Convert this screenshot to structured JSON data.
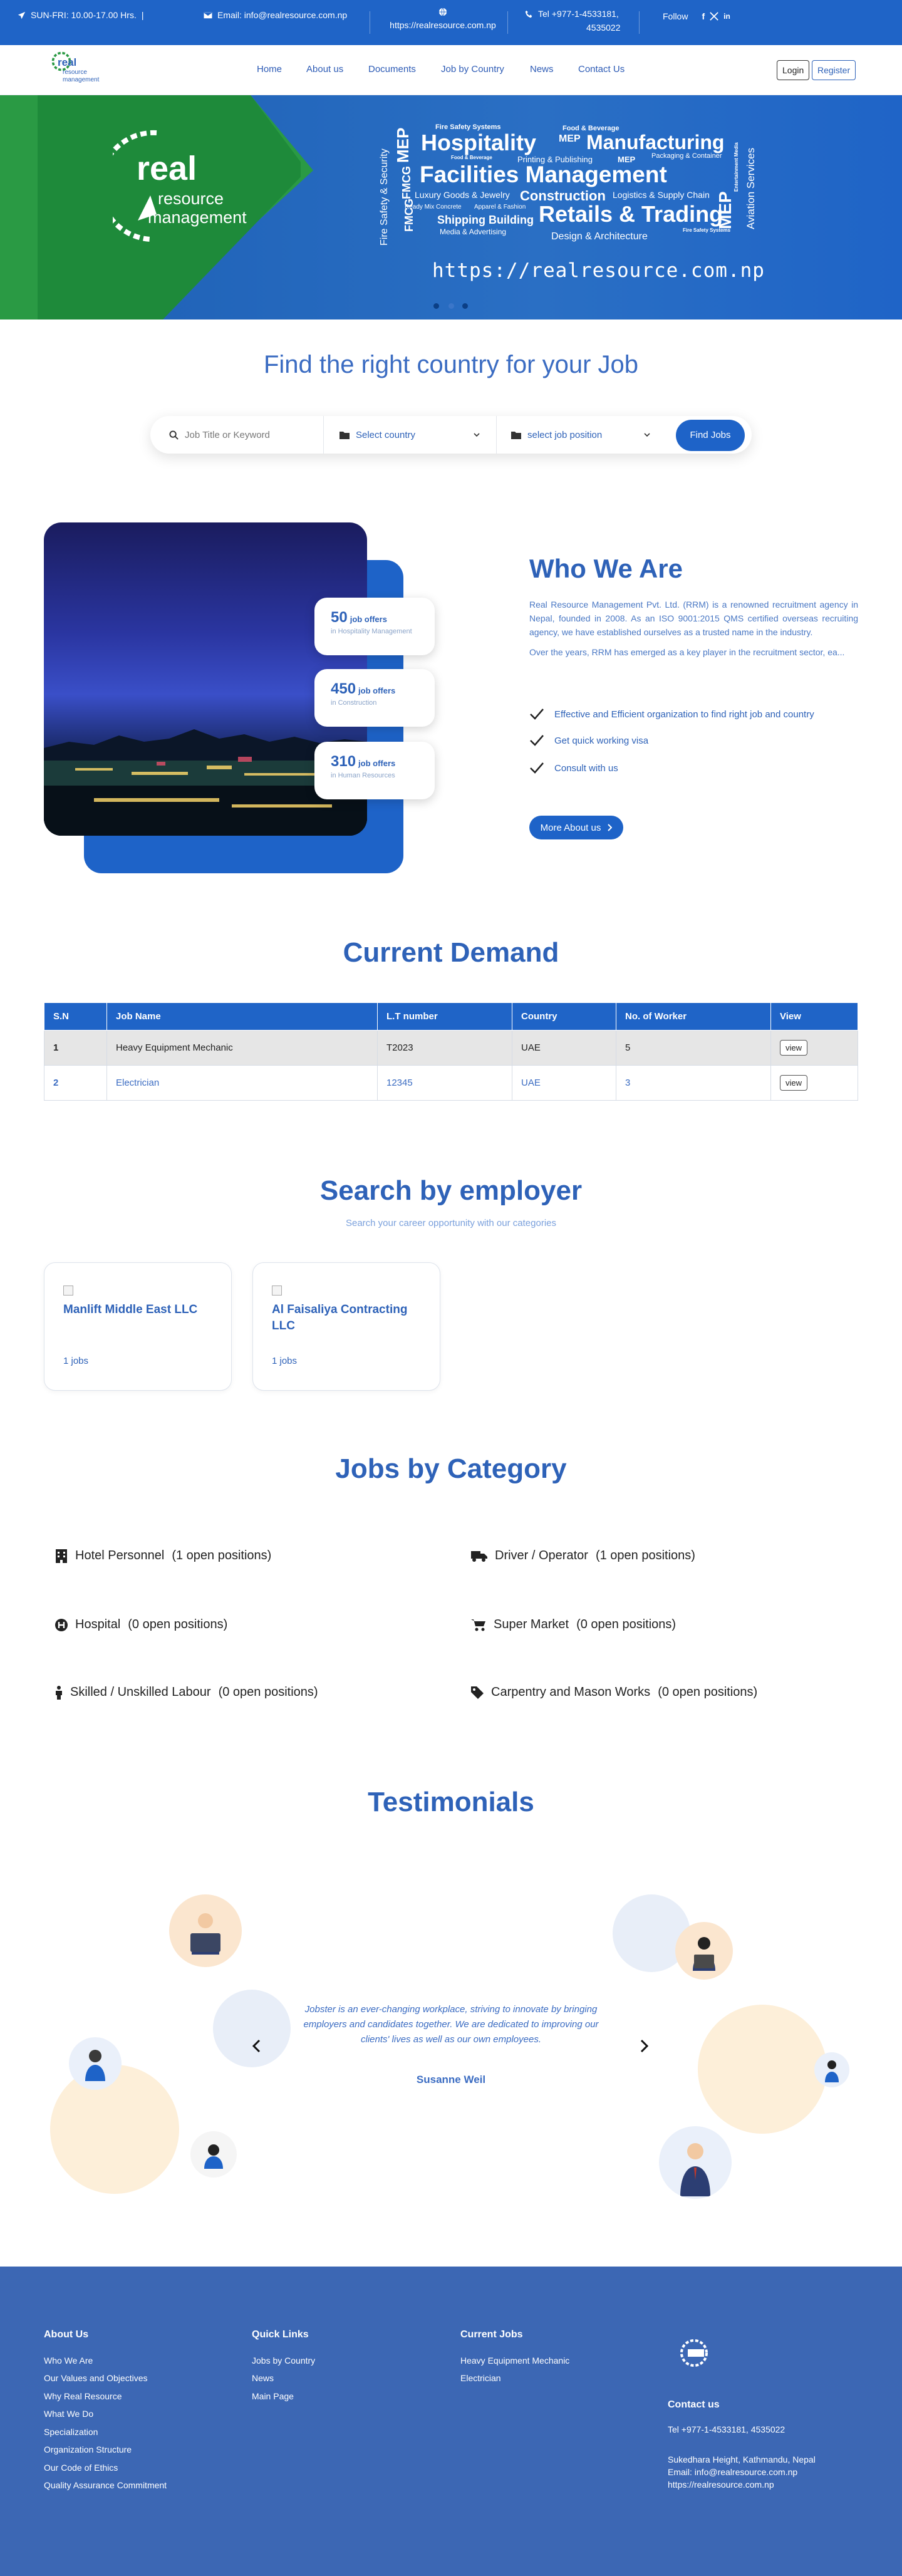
{
  "topbar": {
    "hours": "SUN-FRI: 10.00-17.00 Hrs.",
    "pipe": "|",
    "email": "Email: info@realresource.com.np",
    "website": "https://realresource.com.np",
    "tel_line1": "Tel +977-1-4533181,",
    "tel_line2": "4535022",
    "follow": "Follow"
  },
  "nav": {
    "logo_line1": "real",
    "logo_line2": "resource",
    "logo_line3": "management",
    "links": [
      "Home",
      "About us",
      "Documents",
      "Job by Country",
      "News",
      "Contact Us"
    ],
    "login": "Login",
    "register": "Register"
  },
  "hero": {
    "logo_real": "real",
    "logo_resource": "resource",
    "logo_management": "management",
    "words": {
      "fire_safety_systems": "Fire Safety Systems",
      "food_beverage": "Food & Beverage",
      "hospitality": "Hospitality",
      "mep_a": "MEP",
      "manufacturing": "Manufacturing",
      "food_bev_small": "Food & Beverage",
      "printing": "Printing & Publishing",
      "mep_b": "MEP",
      "packaging": "Packaging & Container",
      "facilities": "Facilities Management",
      "luxury": "Luxury Goods & Jewelry",
      "construction": "Construction",
      "logistics": "Logistics & Supply Chain",
      "ready_mix": "Ready Mix Concrete",
      "apparel": "Apparel & Fashion",
      "retails": "Retails & Trading",
      "shipping": "Shipping Building",
      "fire_safety_small": "Fire Safety Systems",
      "media": "Media & Advertising",
      "design": "Design & Architecture",
      "vert_fire": "Fire Safety & Security",
      "vert_mep": "MEP",
      "vert_fmcg_a": "FMCG",
      "vert_fmcg_b": "FMCG",
      "vert_mep_right": "MEP",
      "vert_aviation": "Aviation Services",
      "vert_entertainment": "Entertainment Media"
    },
    "url": "https://realresource.com.np"
  },
  "find": {
    "title": "Find the right country for your Job",
    "keyword_placeholder": "Job Title or Keyword",
    "country_select": "Select country",
    "position_select": "select job position",
    "button": "Find Jobs"
  },
  "stats": [
    {
      "num": "50",
      "label": "job offers",
      "sub": "in Hospitality Management"
    },
    {
      "num": "450",
      "label": "job offers",
      "sub": "in Construction"
    },
    {
      "num": "310",
      "label": "job offers",
      "sub": "in Human Resources"
    }
  ],
  "who": {
    "title": "Who We Are",
    "para1": "Real Resource Management Pvt. Ltd. (RRM) is a renowned recruitment agency in Nepal, founded in 2008. As an ISO 9001:2015 QMS certified overseas recruiting agency, we have established ourselves as a trusted name in the industry.",
    "para2": "Over the years, RRM has emerged as a key player in the recruitment sector, ea...",
    "checks": [
      "Effective and Efficient organization to find right job and country",
      "Get quick working visa",
      "Consult with us"
    ],
    "button": "More About us"
  },
  "demand": {
    "title": "Current Demand",
    "headers": [
      "S.N",
      "Job Name",
      "L.T number",
      "Country",
      "No. of Worker",
      "View"
    ],
    "rows": [
      {
        "sn": "1",
        "job": "Heavy Equipment Mechanic",
        "lt": "T2023",
        "country": "UAE",
        "workers": "5",
        "view": "view"
      },
      {
        "sn": "2",
        "job": "Electrician",
        "lt": "12345",
        "country": "UAE",
        "workers": "3",
        "view": "view"
      }
    ]
  },
  "employer": {
    "title": "Search by employer",
    "subtitle": "Search your career opportunity with our categories",
    "cards": [
      {
        "name": "Manlift Middle East LLC",
        "jobs": "1 jobs"
      },
      {
        "name": "Al Faisaliya Contracting LLC",
        "jobs": "1 jobs"
      }
    ]
  },
  "category": {
    "title": "Jobs by Category",
    "items": [
      {
        "name": "Hotel Personnel",
        "count": "(1 open positions)",
        "icon": "hotel-icon"
      },
      {
        "name": "Driver / Operator",
        "count": "(1 open positions)",
        "icon": "truck-icon"
      },
      {
        "name": "Hospital",
        "count": "(0 open positions)",
        "icon": "hospital-icon"
      },
      {
        "name": "Super Market",
        "count": "(0 open positions)",
        "icon": "cart-icon"
      },
      {
        "name": "Skilled / Unskilled Labour",
        "count": "(0 open positions)",
        "icon": "person-icon"
      },
      {
        "name": "Carpentry and Mason Works",
        "count": "(0 open positions)",
        "icon": "tag-icon"
      }
    ]
  },
  "testimonials": {
    "title": "Testimonials",
    "quote": "Jobster is an ever-changing workplace, striving to innovate by bringing employers and candidates together. We are dedicated to improving our clients' lives as well as our own employees.",
    "author": "Susanne Weil"
  },
  "footer": {
    "about_title": "About Us",
    "about_links": [
      "Who We Are",
      "Our Values and Objectives",
      "Why Real Resource",
      "What We Do",
      "Specialization",
      "Organization Structure",
      "Our Code of Ethics",
      "Quality Assurance Commitment"
    ],
    "quick_title": "Quick Links",
    "quick_links": [
      "Jobs by Country",
      "News",
      "Main Page"
    ],
    "jobs_title": "Current Jobs",
    "jobs_links": [
      "Heavy Equipment Mechanic",
      "Electrician"
    ],
    "contact_title": "Contact us",
    "tel": "Tel +977-1-4533181, 4535022",
    "address": "Sukedhara Height, Kathmandu, Nepal",
    "email": "Email: info@realresource.com.np",
    "web": "https://realresource.com.np"
  },
  "colors": {
    "primary": "#1f64c7",
    "heading": "#2e62b8",
    "green": "#2a9a44",
    "footer": "#3c67b4"
  }
}
